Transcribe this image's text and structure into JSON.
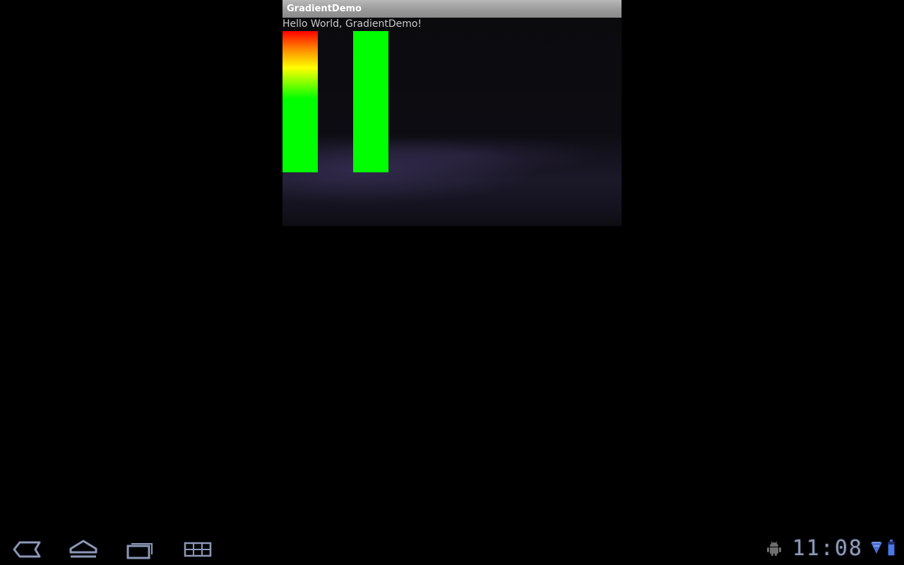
{
  "window": {
    "title": "GradientDemo"
  },
  "content": {
    "hello_text": "Hello World, GradientDemo!"
  },
  "system_bar": {
    "time": "11:08",
    "nav_icons": [
      "back-icon",
      "home-icon",
      "recent-apps-icon",
      "menu-icon"
    ],
    "status_icons": [
      "android-debug-icon",
      "wifi-icon",
      "battery-icon"
    ]
  },
  "colors": {
    "bar_gradient_stops": [
      "#ff0000",
      "#ff8000",
      "#ffff00",
      "#00ff00"
    ],
    "bar_solid": "#00ff00",
    "clock": "#8f9bb8",
    "title_bar": "#a0a0a0"
  }
}
